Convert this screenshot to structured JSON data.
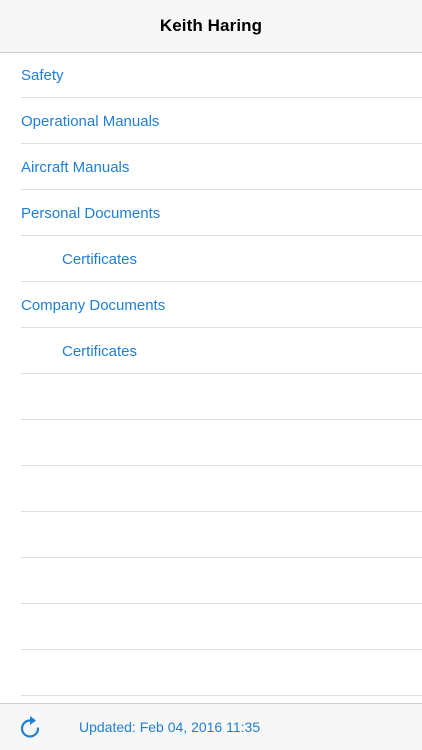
{
  "header": {
    "title": "Keith Haring"
  },
  "menu": {
    "items": [
      {
        "label": "Safety",
        "indent": false
      },
      {
        "label": "Operational Manuals",
        "indent": false
      },
      {
        "label": "Aircraft Manuals",
        "indent": false
      },
      {
        "label": "Personal Documents",
        "indent": false
      },
      {
        "label": "Certificates",
        "indent": true
      },
      {
        "label": "Company Documents",
        "indent": false
      },
      {
        "label": "Certificates",
        "indent": true
      }
    ]
  },
  "toolbar": {
    "updated_text": "Updated: Feb 04, 2016 11:35",
    "refresh_icon": "refresh-icon"
  },
  "colors": {
    "accent": "#1f7fd6",
    "bar_background": "#f7f7f7",
    "separator": "#dedee2"
  }
}
